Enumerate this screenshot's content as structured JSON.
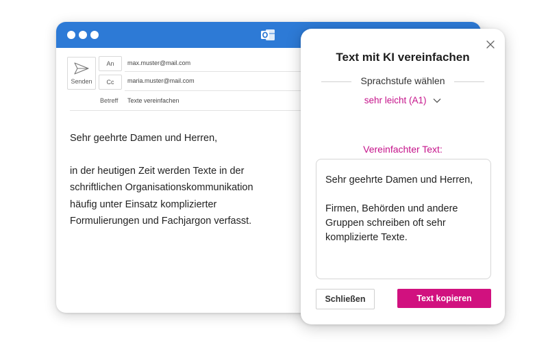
{
  "mail": {
    "send_label": "Senden",
    "to_label": "An",
    "to_value": "max.muster@mail.com",
    "cc_label": "Cc",
    "cc_value": "maria.muster@mail.com",
    "subject_label": "Betreff",
    "subject_value": "Texte vereinfachen",
    "body": {
      "greeting": "Sehr geehrte Damen und Herren,",
      "lines": [
        "in der heutigen Zeit werden Texte in der",
        "schriftlichen Organisationskommunikation",
        "häufig unter Einsatz komplizierter",
        "Formulierungen und Fachjargon verfasst."
      ]
    },
    "colors": {
      "titlebar": "#2d7ad6"
    },
    "icons": {
      "app": "outlook-icon",
      "send": "send-icon"
    }
  },
  "dialog": {
    "title": "Text mit KI vereinfachen",
    "level_label": "Sprachstufe wählen",
    "level_selected": "sehr leicht (A1)",
    "result_label": "Vereinfachter Text:",
    "result_text": "Sehr geehrte Damen und Herren,\n\nFirmen, Behörden und andere Gruppen schreiben oft sehr komplizierte Texte.",
    "close_label": "Schließen",
    "copy_label": "Text kopieren",
    "colors": {
      "accent": "#c5128a",
      "button": "#d1117f"
    }
  }
}
